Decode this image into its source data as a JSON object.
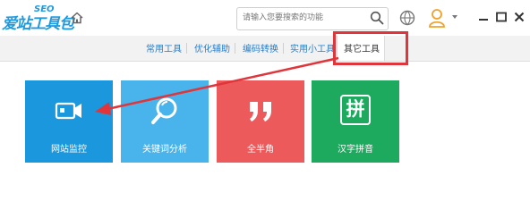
{
  "app": {
    "logo_text": "爱站工具包",
    "logo_badge": "SEO",
    "brand_color": "#1e9be0"
  },
  "header": {
    "search_placeholder": "请输入您要搜索的功能",
    "icons": [
      "home-icon",
      "search-icon",
      "basketball-icon",
      "user-avatar-icon",
      "dropdown-caret-icon",
      "minimize-icon",
      "maximize-icon",
      "close-icon"
    ]
  },
  "tabs": [
    {
      "label": "常用工具",
      "active": false
    },
    {
      "label": "优化辅助",
      "active": false
    },
    {
      "label": "编码转换",
      "active": false
    },
    {
      "label": "实用小工具",
      "active": false
    },
    {
      "label": "其它工具",
      "active": true
    }
  ],
  "tiles": [
    {
      "label": "网站监控",
      "color": "#1b97dd",
      "icon": "camera-monitor-icon"
    },
    {
      "label": "关键词分析",
      "color": "#49b4ec",
      "icon": "magnifier-icon"
    },
    {
      "label": "全半角",
      "color": "#ec5a5b",
      "icon": "quote-marks-icon"
    },
    {
      "label": "汉字拼音",
      "color": "#1daa5e",
      "icon": "pin-character-icon",
      "glyph": "拼"
    }
  ],
  "annotation": {
    "color": "#e0353b"
  }
}
